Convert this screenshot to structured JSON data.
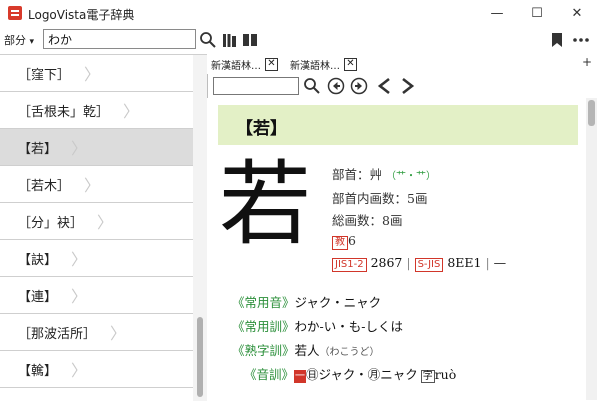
{
  "window": {
    "title": "LogoVista電子辞典",
    "minimize_glyph": "—",
    "maximize_glyph": "☐",
    "close_glyph": "✕"
  },
  "toolbar": {
    "mode_label": "部分",
    "mode_arrow": "▾",
    "search_value": "わか",
    "icons": [
      "search-icon",
      "books-icon",
      "columns-icon",
      "bookmark-icon",
      "more-icon"
    ]
  },
  "result_list": {
    "chevron": "〉",
    "items": [
      {
        "label": "［窪下］",
        "selected": false
      },
      {
        "label": "［舌根未」乾］",
        "selected": false
      },
      {
        "label": "【若】",
        "selected": true
      },
      {
        "label": "［若木］",
        "selected": false
      },
      {
        "label": "［分」袂］",
        "selected": false
      },
      {
        "label": "【訣】",
        "selected": false
      },
      {
        "label": "【連】",
        "selected": false
      },
      {
        "label": "［那波活所］",
        "selected": false
      },
      {
        "label": "【䮧】",
        "selected": false
      }
    ]
  },
  "tabs": {
    "items": [
      {
        "label": "新漢語林…",
        "close": "✕"
      },
      {
        "label": "新漢語林…",
        "close": "✕"
      }
    ],
    "add_label": "+"
  },
  "content_toolbar": {
    "icons": [
      "search-icon",
      "circle-back-icon",
      "circle-forward-icon",
      "back-arrow-icon",
      "forward-arrow-icon"
    ]
  },
  "entry": {
    "headword": "【若】",
    "big_kanji": "若",
    "radical_label": "部首：艸",
    "radical_variants": "（艹・⺾）",
    "inner_strokes": "部首内画数：5画",
    "total_strokes": "総画数：8画",
    "grade_badge": "教",
    "grade_value": "6",
    "jis_badge": "JIS1-2",
    "jis_code": "2867",
    "sjis_badge": "S-JIS",
    "sjis_code": "8EE1",
    "sep": "|",
    "dash": "—",
    "readings": [
      {
        "tag": "《常用音》",
        "text": "ジャク・ニャク"
      },
      {
        "tag": "《常用訓》",
        "text": "わか-い・も-しくは"
      },
      {
        "tag": "《熟字訓》",
        "text": "若人",
        "note": "（わこうど）"
      }
    ],
    "on_reading": {
      "tag": "《音訓》",
      "badge1": "一",
      "go_mark": "㊐",
      "go_text": "ジャク・",
      "kan_mark": "㊊",
      "kan_text": "ニャク",
      "pinyin_box": "字",
      "pinyin": "ruò"
    }
  }
}
